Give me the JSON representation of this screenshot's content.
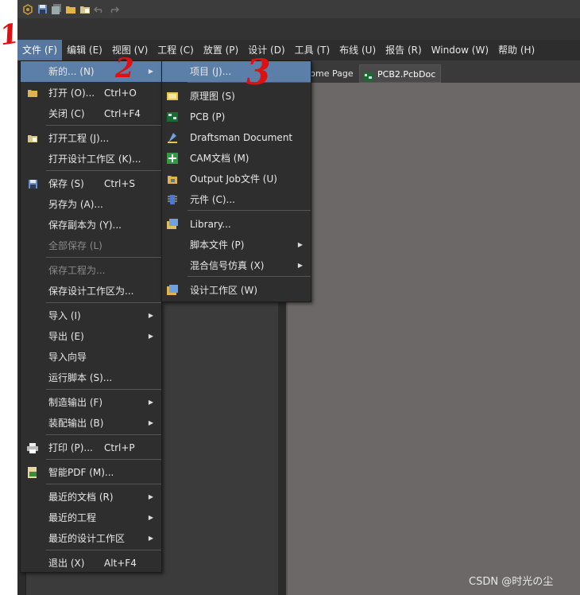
{
  "annotations": [
    "1",
    "2",
    "3"
  ],
  "quickbar": {
    "icons": [
      "app-logo-icon",
      "save-icon",
      "save-all-icon",
      "open-folder-icon",
      "open-project-icon",
      "undo-icon",
      "redo-icon"
    ]
  },
  "menubar": {
    "items": [
      {
        "label": "文件 (F)",
        "active": true
      },
      {
        "label": "编辑 (E)"
      },
      {
        "label": "视图 (V)"
      },
      {
        "label": "工程 (C)"
      },
      {
        "label": "放置 (P)"
      },
      {
        "label": "设计 (D)"
      },
      {
        "label": "工具 (T)"
      },
      {
        "label": "布线 (U)"
      },
      {
        "label": "报告 (R)"
      },
      {
        "label": "Window (W)"
      },
      {
        "label": "帮助 (H)"
      }
    ]
  },
  "tabs": {
    "home": "Home Page",
    "pcb": "PCB2.PcbDoc"
  },
  "file_menu": {
    "items": [
      {
        "label": "新的... (N)",
        "shortcut": "",
        "submenu": true,
        "highlighted": true
      },
      {
        "label": "打开 (O)...",
        "shortcut": "Ctrl+O"
      },
      {
        "label": "关闭 (C)",
        "shortcut": "Ctrl+F4"
      },
      {
        "label": "打开工程 (J)..."
      },
      {
        "label": "打开设计工作区 (K)..."
      },
      {
        "label": "保存 (S)",
        "shortcut": "Ctrl+S"
      },
      {
        "label": "另存为 (A)..."
      },
      {
        "label": "保存副本为 (Y)..."
      },
      {
        "label": "全部保存 (L)",
        "disabled": true
      },
      {
        "label": "保存工程为...",
        "disabled": true
      },
      {
        "label": "保存设计工作区为..."
      },
      {
        "label": "导入 (I)",
        "submenu": true
      },
      {
        "label": "导出 (E)",
        "submenu": true
      },
      {
        "label": "导入向导"
      },
      {
        "label": "运行脚本 (S)..."
      },
      {
        "label": "制造输出 (F)",
        "submenu": true
      },
      {
        "label": "装配输出 (B)",
        "submenu": true
      },
      {
        "label": "打印 (P)...",
        "shortcut": "Ctrl+P"
      },
      {
        "label": "智能PDF (M)..."
      },
      {
        "label": "最近的文档 (R)",
        "submenu": true
      },
      {
        "label": "最近的工程",
        "submenu": true
      },
      {
        "label": "最近的设计工作区",
        "submenu": true
      },
      {
        "label": "退出 (X)",
        "shortcut": "Alt+F4"
      }
    ]
  },
  "new_submenu": {
    "items": [
      {
        "label": "项目 (J)...",
        "highlighted": true
      },
      {
        "label": "原理图 (S)"
      },
      {
        "label": "PCB (P)"
      },
      {
        "label": "Draftsman Document"
      },
      {
        "label": "CAM文档 (M)"
      },
      {
        "label": "Output Job文件 (U)"
      },
      {
        "label": "元件 (C)..."
      },
      {
        "label": "Library..."
      },
      {
        "label": "脚本文件 (P)",
        "submenu": true
      },
      {
        "label": "混合信号仿真 (X)",
        "submenu": true
      },
      {
        "label": "设计工作区 (W)"
      }
    ]
  },
  "watermark": "CSDN @时光の尘",
  "colors": {
    "menu_bg": "#2e2e2e",
    "highlight": "#5b7fa8",
    "annotation": "#e01010"
  }
}
